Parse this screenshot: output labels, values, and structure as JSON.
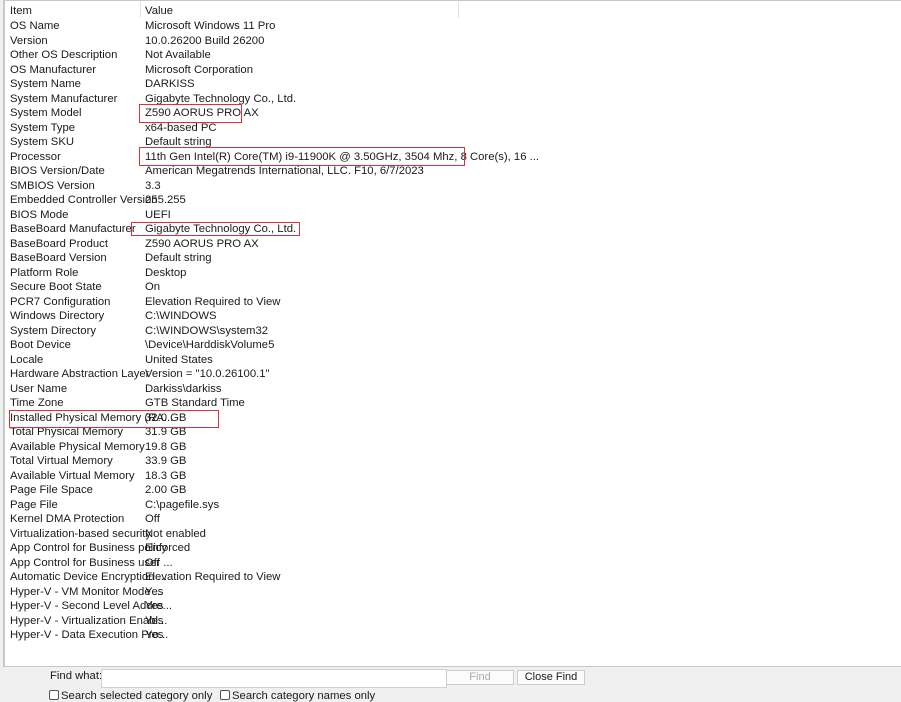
{
  "columns": {
    "item": "Item",
    "value": "Value"
  },
  "rows": [
    [
      "OS Name",
      "Microsoft Windows 11 Pro"
    ],
    [
      "Version",
      "10.0.26200 Build 26200"
    ],
    [
      "Other OS Description",
      "Not Available"
    ],
    [
      "OS Manufacturer",
      "Microsoft Corporation"
    ],
    [
      "System Name",
      "DARKISS"
    ],
    [
      "System Manufacturer",
      "Gigabyte Technology Co., Ltd."
    ],
    [
      "System Model",
      "Z590 AORUS PRO AX"
    ],
    [
      "System Type",
      "x64-based PC"
    ],
    [
      "System SKU",
      "Default string"
    ],
    [
      "Processor",
      "11th Gen Intel(R) Core(TM) i9-11900K @ 3.50GHz, 3504 Mhz, 8 Core(s), 16 ..."
    ],
    [
      "BIOS Version/Date",
      "American Megatrends International, LLC. F10, 6/7/2023"
    ],
    [
      "SMBIOS Version",
      "3.3"
    ],
    [
      "Embedded Controller Version",
      "255.255"
    ],
    [
      "BIOS Mode",
      "UEFI"
    ],
    [
      "BaseBoard Manufacturer",
      "Gigabyte Technology Co., Ltd."
    ],
    [
      "BaseBoard Product",
      "Z590 AORUS PRO AX"
    ],
    [
      "BaseBoard Version",
      "Default string"
    ],
    [
      "Platform Role",
      "Desktop"
    ],
    [
      "Secure Boot State",
      "On"
    ],
    [
      "PCR7 Configuration",
      "Elevation Required to View"
    ],
    [
      "Windows Directory",
      "C:\\WINDOWS"
    ],
    [
      "System Directory",
      "C:\\WINDOWS\\system32"
    ],
    [
      "Boot Device",
      "\\Device\\HarddiskVolume5"
    ],
    [
      "Locale",
      "United States"
    ],
    [
      "Hardware Abstraction Layer",
      "Version = \"10.0.26100.1\""
    ],
    [
      "User Name",
      "Darkiss\\darkiss"
    ],
    [
      "Time Zone",
      "GTB Standard Time"
    ],
    [
      "Installed Physical Memory (RA...",
      "32.0 GB"
    ],
    [
      "Total Physical Memory",
      "31.9 GB"
    ],
    [
      "Available Physical Memory",
      "19.8 GB"
    ],
    [
      "Total Virtual Memory",
      "33.9 GB"
    ],
    [
      "Available Virtual Memory",
      "18.3 GB"
    ],
    [
      "Page File Space",
      "2.00 GB"
    ],
    [
      "Page File",
      "C:\\pagefile.sys"
    ],
    [
      "Kernel DMA Protection",
      "Off"
    ],
    [
      "Virtualization-based security",
      "Not enabled"
    ],
    [
      "App Control for Business policy",
      "Enforced"
    ],
    [
      "App Control for Business user ...",
      "Off"
    ],
    [
      "Automatic Device Encryption ...",
      "Elevation Required to View"
    ],
    [
      "Hyper-V - VM Monitor Mode ...",
      "Yes"
    ],
    [
      "Hyper-V - Second Level Addre...",
      "Yes"
    ],
    [
      "Hyper-V - Virtualization Enabl...",
      "Yes"
    ],
    [
      "Hyper-V - Data Execution Pro...",
      "Yes"
    ]
  ],
  "find": {
    "label": "Find what:",
    "value": "",
    "find_button": "Find",
    "close_button": "Close Find",
    "option1": "Search selected category only",
    "option2": "Search category names only"
  },
  "highlight_color": "#d9323a"
}
